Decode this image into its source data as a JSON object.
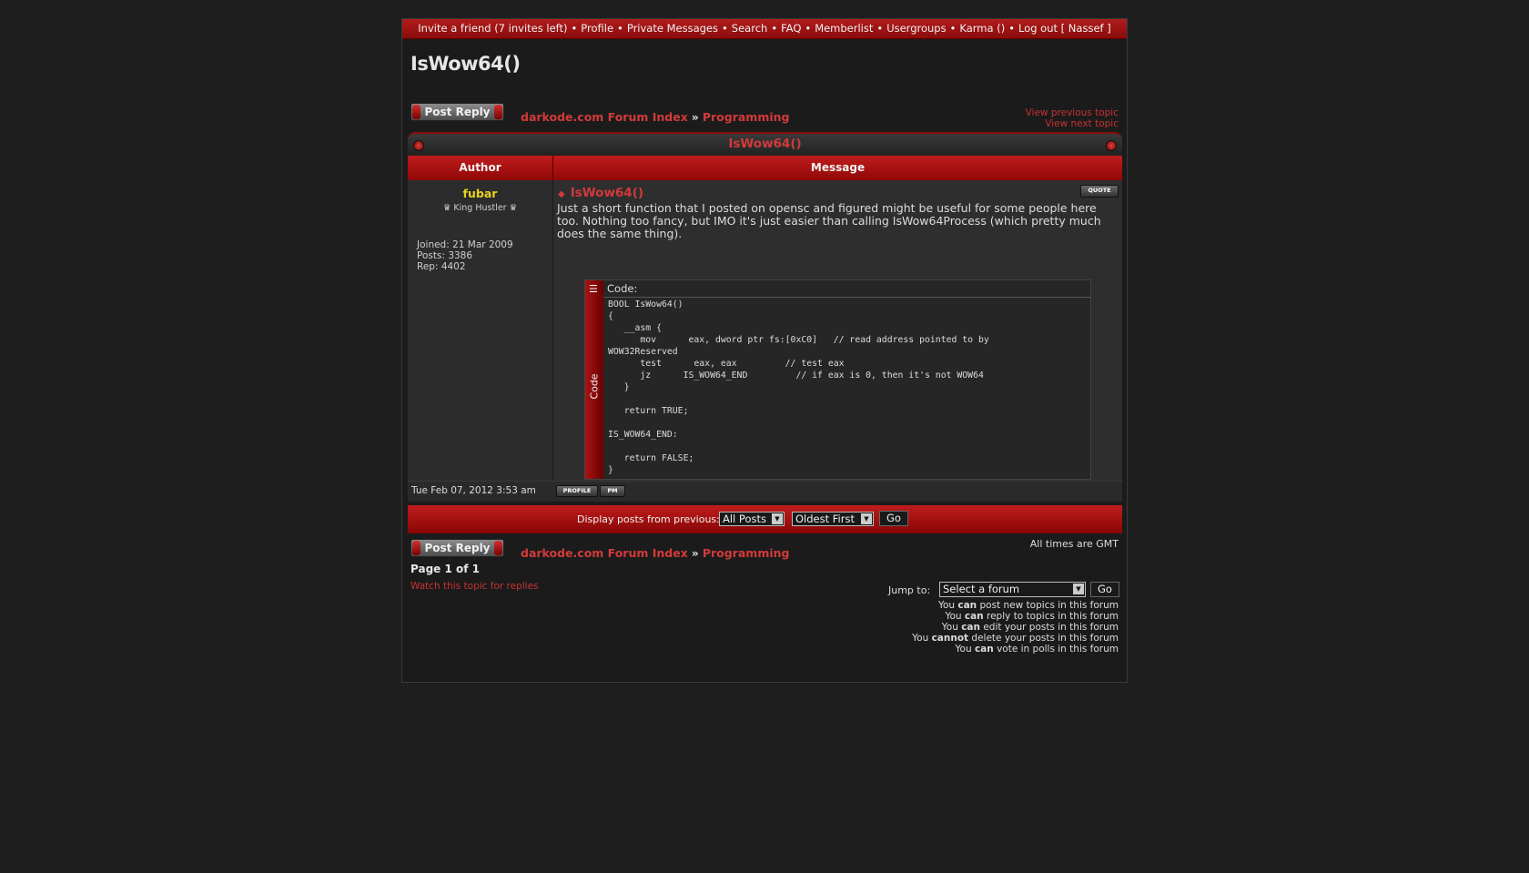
{
  "topnav": [
    "Invite a friend (7 invites left)",
    "Profile",
    "Private Messages",
    "Search",
    "FAQ",
    "Memberlist",
    "Usergroups",
    "Karma ()",
    "Log out [ Nassef ]"
  ],
  "page_title": "IsWow64()",
  "actions": {
    "post_reply": "Post Reply",
    "prev_topic": "View previous topic",
    "next_topic": "View next topic"
  },
  "breadcrumb": {
    "index": "darkode.com Forum Index",
    "sep": "»",
    "forum": "Programming"
  },
  "topic_title": "IsWow64()",
  "table_headers": {
    "author": "Author",
    "message": "Message"
  },
  "post": {
    "author": "fubar",
    "rank": "♛ King Hustler ♛",
    "joined": "Joined: 21 Mar 2009",
    "posts": "Posts: 3386",
    "rep": "Rep: 4402",
    "title": "IsWow64()",
    "quote_label": "QUOTE",
    "body": "Just a short function that I posted on opensc and figured might be useful for some people here too. Nothing too fancy, but IMO it's just easier than calling IsWow64Process (which pretty much does the same thing).",
    "code_label": "Code:",
    "code_side": "Code",
    "code": "BOOL IsWow64()\n{\n   __asm {\n      mov      eax, dword ptr fs:[0xC0]   // read address pointed to by\nWOW32Reserved\n      test      eax, eax         // test eax\n      jz      IS_WOW64_END         // if eax is 0, then it's not WOW64\n   }\n\n   return TRUE;\n\nIS_WOW64_END:\n\n   return FALSE;\n}",
    "date": "Tue Feb 07, 2012 3:53 am",
    "profile_label": "PROFILE",
    "pm_label": "PM"
  },
  "filter": {
    "label": "Display posts from previous:",
    "posts": "All Posts",
    "order": "Oldest First",
    "go": "Go"
  },
  "footer": {
    "timezone": "All times are GMT",
    "page": "Page 1 of 1",
    "watch": "Watch this topic for replies",
    "jump_label": "Jump to:",
    "jump_select": "Select a forum",
    "jump_go": "Go",
    "permissions": [
      {
        "pre": "You ",
        "b": "can",
        "post": " post new topics in this forum"
      },
      {
        "pre": "You ",
        "b": "can",
        "post": " reply to topics in this forum"
      },
      {
        "pre": "You ",
        "b": "can",
        "post": " edit your posts in this forum"
      },
      {
        "pre": "You ",
        "b": "cannot",
        "post": " delete your posts in this forum"
      },
      {
        "pre": "You ",
        "b": "can",
        "post": " vote in polls in this forum"
      }
    ]
  }
}
